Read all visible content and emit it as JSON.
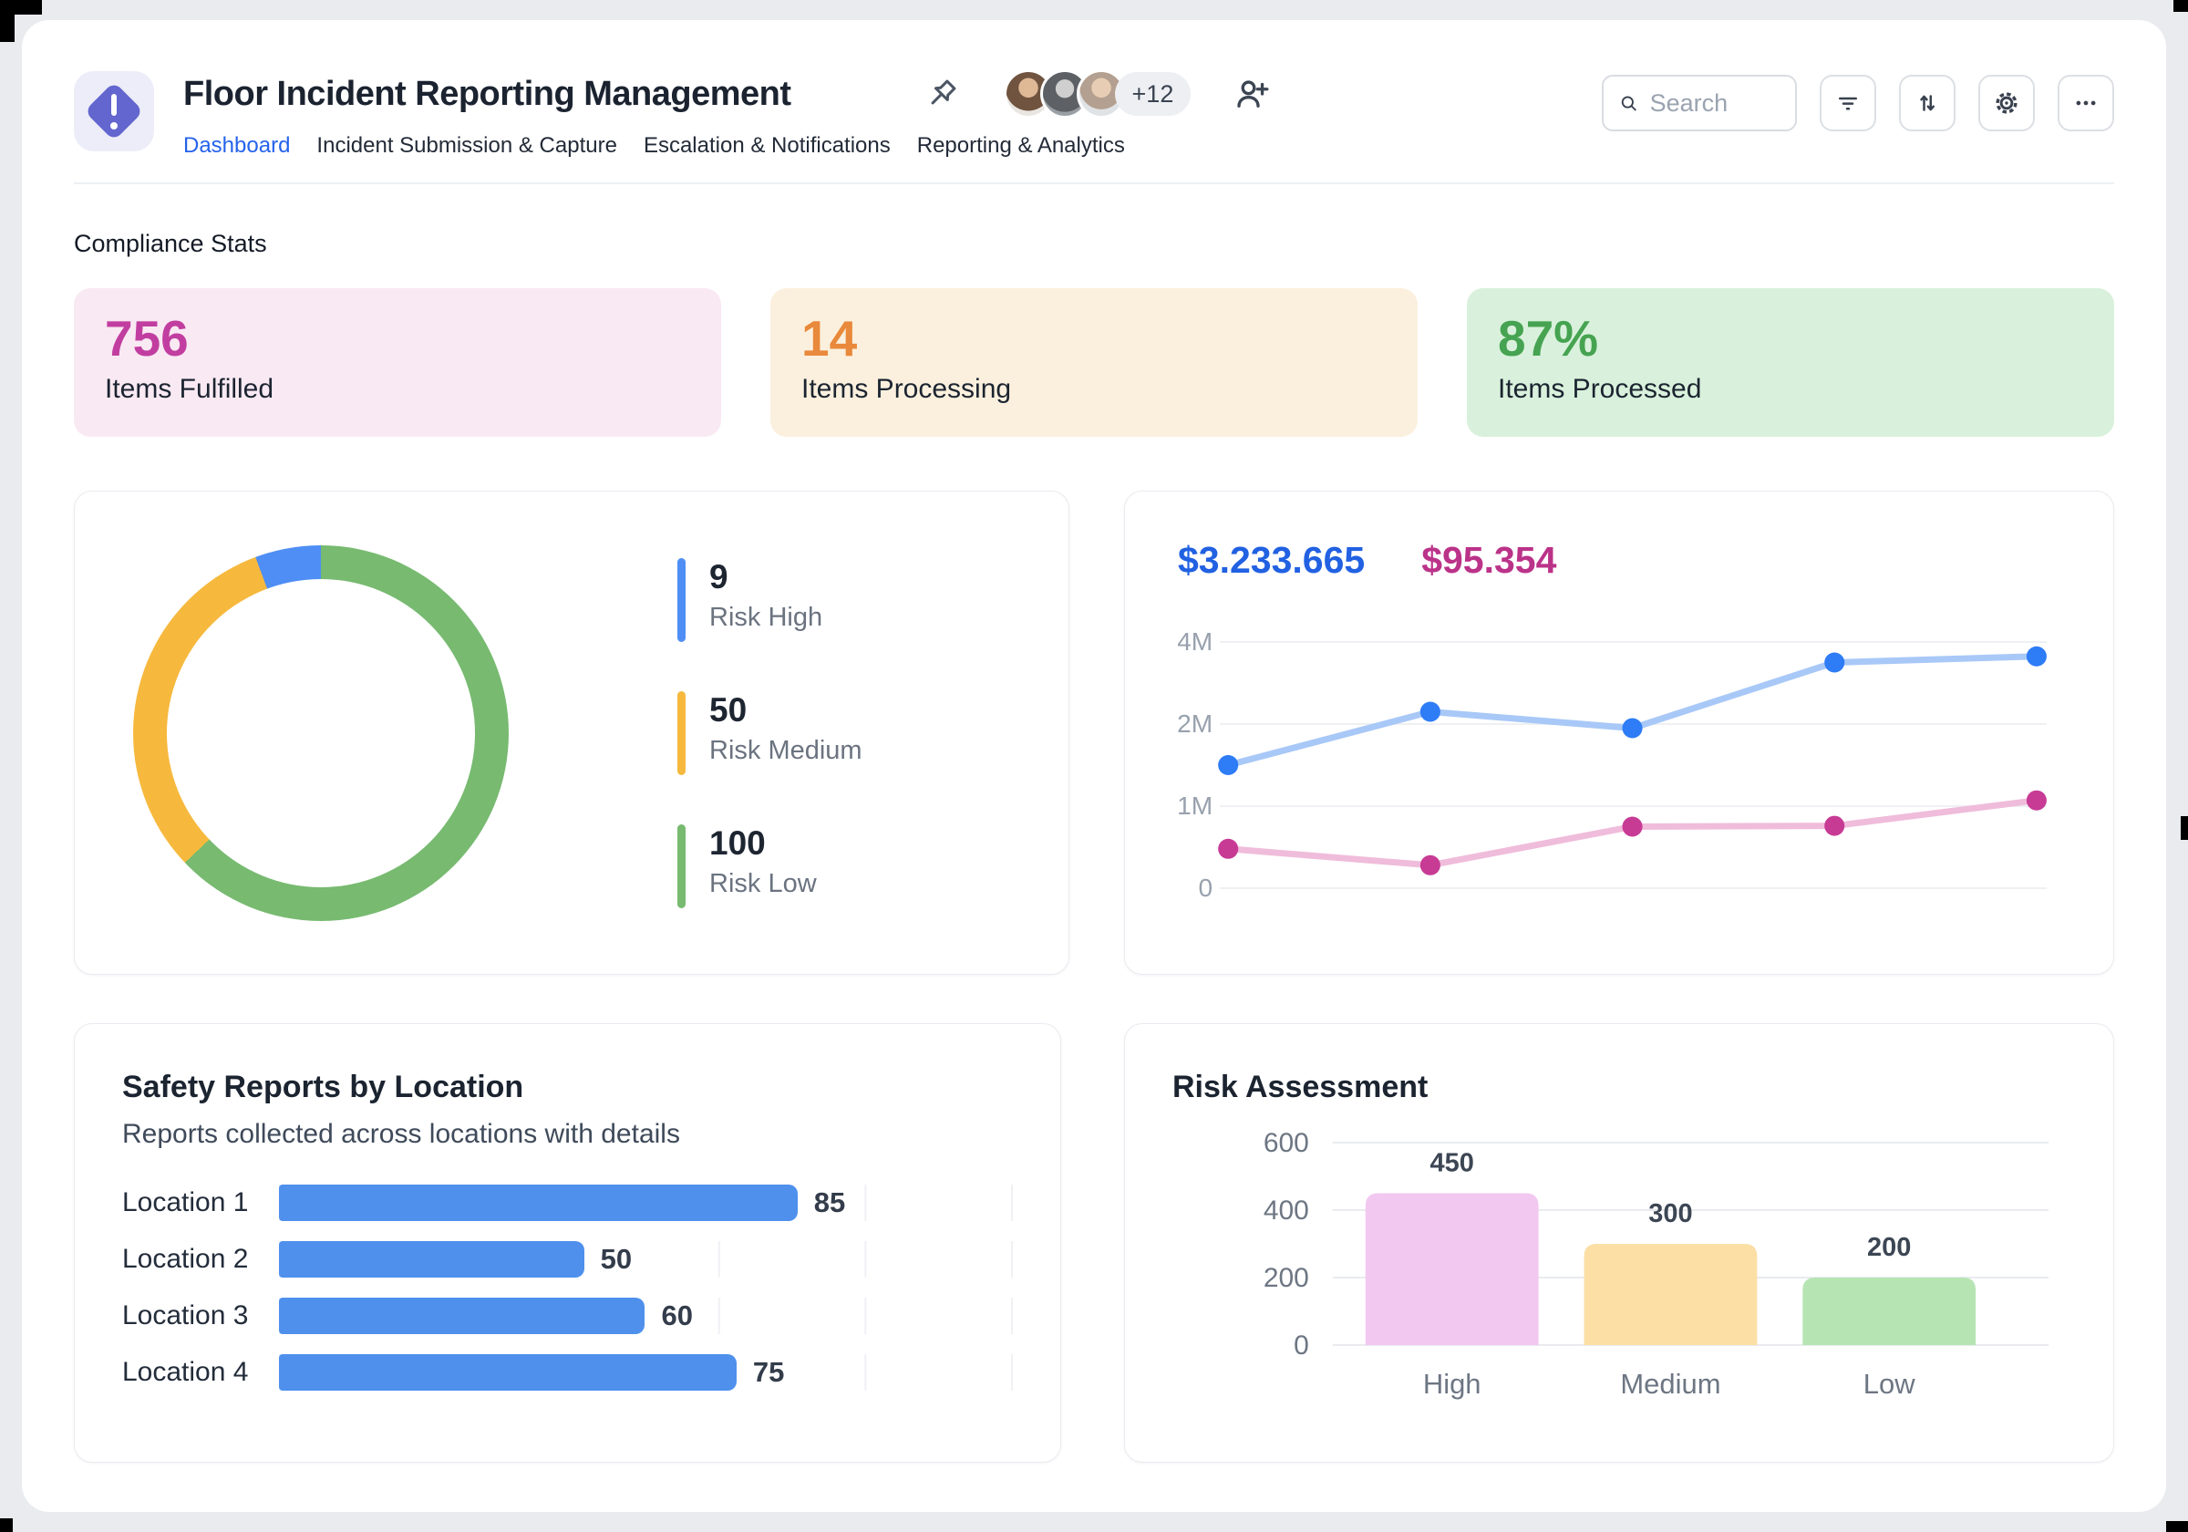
{
  "header": {
    "title": "Floor Incident Reporting Management",
    "app_icon": {
      "shape": "diamond",
      "color": "#6366cf",
      "symbol": "exclamation"
    },
    "tabs": [
      {
        "label": "Dashboard",
        "active": true
      },
      {
        "label": "Incident Submission & Capture",
        "active": false
      },
      {
        "label": "Escalation & Notifications",
        "active": false
      },
      {
        "label": "Reporting & Analytics",
        "active": false
      }
    ],
    "collaborators": {
      "avatar_count": 3,
      "overflow_badge": "+12"
    },
    "search": {
      "placeholder": "Search"
    },
    "actions": [
      "filter",
      "sort",
      "settings",
      "more"
    ]
  },
  "stats": {
    "section_title": "Compliance Stats",
    "cards": [
      {
        "value": "756",
        "label": "Items Fulfilled",
        "bg": "#f9e9f3",
        "accent": "#c13ea0"
      },
      {
        "value": "14",
        "label": "Items Processing",
        "bg": "#fbf0de",
        "accent": "#e9893b"
      },
      {
        "value": "87%",
        "label": "Items Processed",
        "bg": "#d9f1dc",
        "accent": "#46a351"
      }
    ]
  },
  "revenue_card": {
    "primary": {
      "text": "$3.233.665",
      "color": "#2161e2"
    },
    "secondary": {
      "text": "$95.354",
      "color": "#bb3389"
    }
  },
  "chart_data": [
    {
      "id": "risk-donut",
      "type": "pie",
      "donut": true,
      "labels": [
        "Risk High",
        "Risk Medium",
        "Risk Low"
      ],
      "values": [
        9,
        50,
        100
      ],
      "colors": [
        "#4e8ef5",
        "#f6b93e",
        "#77ba70"
      ],
      "legend_position": "right"
    },
    {
      "id": "revenue-trend",
      "type": "line",
      "grid": true,
      "x_labels_shown": false,
      "y_scale": "equal-tick-spacing",
      "yticks": [
        {
          "label": "0",
          "value": 0
        },
        {
          "label": "1M",
          "value": 1000000
        },
        {
          "label": "2M",
          "value": 2000000
        },
        {
          "label": "4M",
          "value": 4000000
        }
      ],
      "series": [
        {
          "name": "$3.233.665",
          "color_line": "#a8c8f7",
          "color_point": "#2e7cf6",
          "values": [
            1500000,
            2300000,
            1950000,
            3500000,
            3650000
          ]
        },
        {
          "name": "$95.354",
          "color_line": "#f0bcdb",
          "color_point": "#c73b95",
          "values": [
            480000,
            280000,
            750000,
            760000,
            1070000
          ]
        }
      ]
    },
    {
      "id": "safety-reports",
      "type": "bar",
      "orientation": "horizontal",
      "title": "Safety Reports by Location",
      "subtitle": "Reports collected across locations with details",
      "categories": [
        "Location 1",
        "Location 2",
        "Location 3",
        "Location 4"
      ],
      "values": [
        85,
        50,
        60,
        75
      ],
      "bar_color": "#4e90ec",
      "xmax": 120,
      "grid_step": 25,
      "value_labels": true
    },
    {
      "id": "risk-assessment",
      "type": "bar",
      "orientation": "vertical",
      "title": "Risk Assessment",
      "categories": [
        "High",
        "Medium",
        "Low"
      ],
      "values": [
        450,
        300,
        200
      ],
      "colors": [
        "#f2c8f0",
        "#fbdfa4",
        "#b6e5b3"
      ],
      "yticks": [
        0,
        200,
        400,
        600
      ],
      "ylim": [
        0,
        600
      ],
      "grid": true,
      "value_labels": true
    }
  ]
}
